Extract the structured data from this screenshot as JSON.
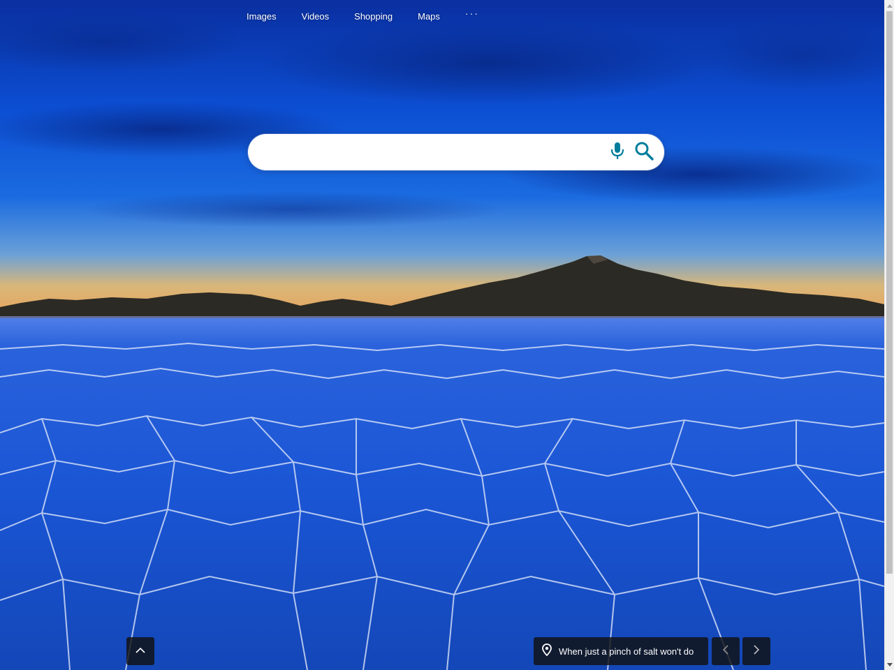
{
  "nav": {
    "items": [
      {
        "label": "Images"
      },
      {
        "label": "Videos"
      },
      {
        "label": "Shopping"
      },
      {
        "label": "Maps"
      }
    ],
    "more_label": "···"
  },
  "search": {
    "value": "",
    "placeholder": ""
  },
  "background": {
    "caption": "When just a pinch of salt won't do"
  },
  "colors": {
    "accent": "#007d9c",
    "sky_top": "#0b3db8",
    "salt_flat": "#1a56d6"
  },
  "icons": {
    "mic": "microphone-icon",
    "search": "search-icon",
    "location": "location-pin-icon",
    "collapse": "chevron-up-icon",
    "prev": "chevron-left-icon",
    "next": "chevron-right-icon"
  }
}
